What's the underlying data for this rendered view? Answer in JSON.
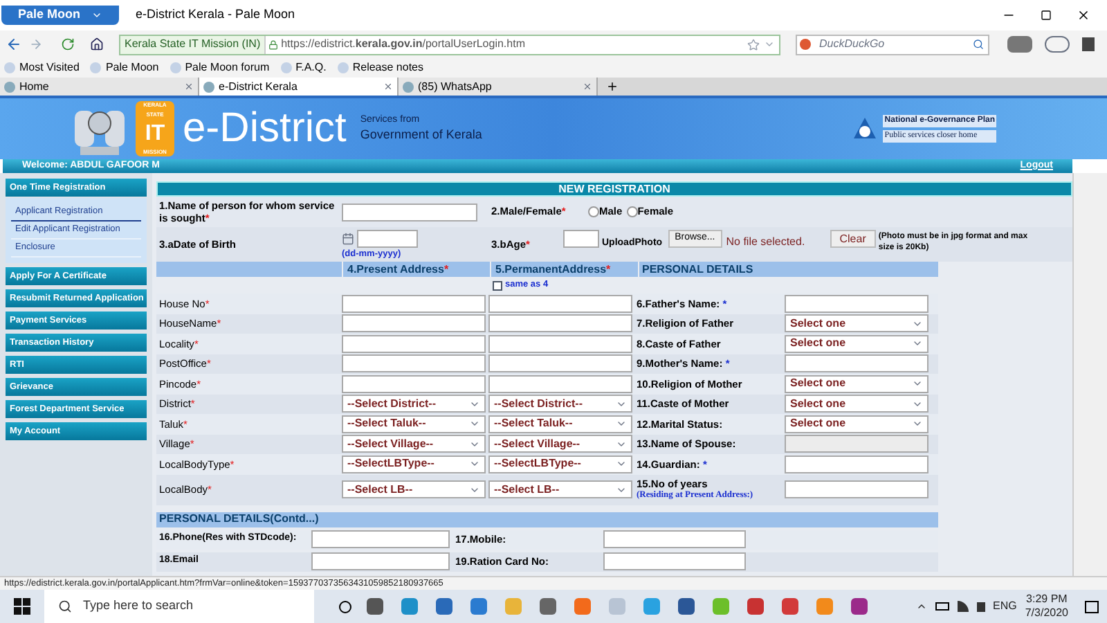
{
  "browser": {
    "app_button": "Pale Moon",
    "window_title": "e-District Kerala - Pale Moon",
    "identity": "Kerala State IT Mission (IN)",
    "url": "https://edistrict.**kerala.gov.in**/portalUserLogin.htm",
    "search_placeholder": "DuckDuckGo",
    "bookmarks": [
      "Most Visited",
      "Pale Moon",
      "Pale Moon forum",
      "F.A.Q.",
      "Release notes"
    ],
    "tabs": [
      {
        "label": "Home",
        "selected": false
      },
      {
        "label": "e-District Kerala",
        "selected": true
      },
      {
        "label": "(85) WhatsApp",
        "selected": false
      }
    ]
  },
  "header": {
    "badge": [
      "KERALA",
      "STATE",
      "IT",
      "MISSION"
    ],
    "title": "e-District",
    "subtitle": "Services from",
    "subtitle2": "Government of Kerala",
    "negp": "National e-Governance Plan",
    "tagline": "Public services closer home",
    "welcome": "Welcome: ABDUL GAFOOR M",
    "logout": "Logout"
  },
  "sidebar": [
    {
      "label": "One Time Registration",
      "children": [
        {
          "label": "Applicant Registration",
          "selected": true
        },
        {
          "label": "Edit Applicant Registration",
          "selected": false
        },
        {
          "label": "Enclosure",
          "selected": false
        }
      ]
    },
    {
      "label": "Apply For A Certificate"
    },
    {
      "label": "Resubmit Returned Application"
    },
    {
      "label": "Payment Services"
    },
    {
      "label": "Transaction History"
    },
    {
      "label": "RTI"
    },
    {
      "label": "Grievance"
    },
    {
      "label": "Forest Department Service"
    },
    {
      "label": "My Account"
    }
  ],
  "form": {
    "title": "NEW REGISTRATION",
    "name_label": "1.Name of person for whom service is sought",
    "gender_label": "2.Male/Female",
    "mark": "*",
    "gender_options": [
      {
        "label": "Male",
        "selected": false
      },
      {
        "label": "Female",
        "selected": false
      }
    ],
    "dob_label": "3.aDate of Birth",
    "dob_hint": "(dd-mm-yyyy)",
    "age_label": "3.bAge",
    "upload_label": "UploadPhoto",
    "browse": "Browse...",
    "file_status": "No file selected.",
    "clear": "Clear",
    "photo_note": "(Photo must be in jpg format and max size is 20Kb)",
    "present_heading": "4.Present Address",
    "permanent_heading": "5.PermanentAddress",
    "personal_heading": "PERSONAL DETAILS",
    "same_as": {
      "label": "same as 4",
      "checked": false
    },
    "rows": [
      {
        "address": {
          "label": "House No",
          "kind": "text"
        },
        "personal": {
          "label": "6.Father's Name:",
          "mark": "*",
          "kind": "text"
        }
      },
      {
        "address": {
          "label": "HouseName",
          "kind": "text"
        },
        "personal": {
          "label": "7.Religion of Father",
          "kind": "select",
          "value": "Select one"
        }
      },
      {
        "address": {
          "label": "Locality",
          "kind": "text"
        },
        "personal": {
          "label": "8.Caste of Father",
          "kind": "select",
          "value": "Select one"
        }
      },
      {
        "address": {
          "label": "PostOffice",
          "kind": "text"
        },
        "personal": {
          "label": "9.Mother's Name:",
          "mark": "*",
          "kind": "text"
        }
      },
      {
        "address": {
          "label": "Pincode",
          "kind": "text"
        },
        "personal": {
          "label": "10.Religion of Mother",
          "kind": "select",
          "value": "Select one"
        }
      },
      {
        "address": {
          "label": "District",
          "kind": "select",
          "present": "--Select District--",
          "permanent": "--Select District--"
        },
        "personal": {
          "label": "11.Caste of Mother",
          "kind": "select",
          "value": "Select one"
        }
      },
      {
        "address": {
          "label": "Taluk",
          "kind": "select",
          "present": "--Select Taluk--",
          "permanent": "--Select Taluk--"
        },
        "personal": {
          "label": "12.Marital Status:",
          "kind": "select",
          "value": "Select one"
        }
      },
      {
        "address": {
          "label": "Village",
          "kind": "select",
          "present": "--Select Village--",
          "permanent": "--Select Village--"
        },
        "personal": {
          "label": "13.Name of Spouse:",
          "kind": "disabled"
        }
      },
      {
        "address": {
          "label": "LocalBodyType",
          "kind": "select",
          "present": "--SelectLBType--",
          "permanent": "--SelectLBType--"
        },
        "personal": {
          "label": "14.Guardian:",
          "mark": "*",
          "kind": "text"
        }
      },
      {
        "address": {
          "label": "LocalBody",
          "kind": "select",
          "present": "--Select LB--",
          "permanent": "--Select LB--"
        },
        "personal": {
          "label": "15.No of years",
          "note": "(Residing at Present Address:)",
          "kind": "text"
        }
      }
    ],
    "contd_heading": "PERSONAL DETAILS(Contd...)",
    "contd_rows": [
      {
        "left": "16.Phone(Res with STDcode):",
        "right": "17.Mobile:"
      },
      {
        "left": "18.Email",
        "right": "19.Ration Card No:"
      }
    ]
  },
  "status_url": "https://edistrict.kerala.gov.in/portalApplicant.htm?frmVar=online&token=159377037356343105985218093766​5",
  "taskbar": {
    "search": "Type here to search",
    "lang": "ENG",
    "time": "3:29 PM",
    "date": "7/3/2020"
  }
}
